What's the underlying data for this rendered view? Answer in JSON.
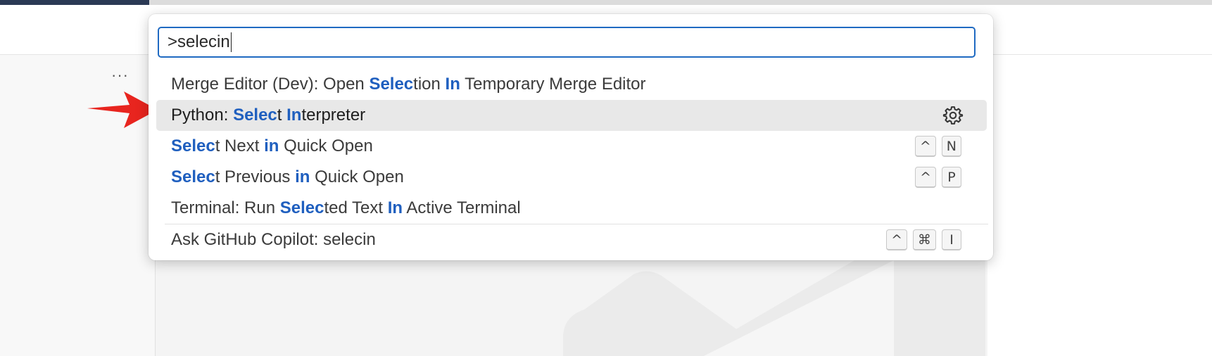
{
  "quick_pick": {
    "query": ">selecin",
    "items": [
      {
        "segments": [
          {
            "t": "Merge Editor (Dev): Open ",
            "h": false
          },
          {
            "t": "Selec",
            "h": true
          },
          {
            "t": "tion ",
            "h": false
          },
          {
            "t": "In",
            "h": true
          },
          {
            "t": " Temporary Merge Editor",
            "h": false
          }
        ],
        "selected": false,
        "keys": []
      },
      {
        "segments": [
          {
            "t": "Python: ",
            "h": false
          },
          {
            "t": "Selec",
            "h": true
          },
          {
            "t": "t ",
            "h": false
          },
          {
            "t": "In",
            "h": true
          },
          {
            "t": "terpreter",
            "h": false
          }
        ],
        "selected": true,
        "action_icon": "gear-icon",
        "keys": []
      },
      {
        "segments": [
          {
            "t": "Selec",
            "h": true
          },
          {
            "t": "t Next ",
            "h": false
          },
          {
            "t": "in",
            "h": true
          },
          {
            "t": " Quick Open",
            "h": false
          }
        ],
        "selected": false,
        "keys": [
          "^",
          "N"
        ]
      },
      {
        "segments": [
          {
            "t": "Selec",
            "h": true
          },
          {
            "t": "t Previous ",
            "h": false
          },
          {
            "t": "in",
            "h": true
          },
          {
            "t": " Quick Open",
            "h": false
          }
        ],
        "selected": false,
        "keys": [
          "^",
          "P"
        ]
      },
      {
        "segments": [
          {
            "t": "Terminal: Run ",
            "h": false
          },
          {
            "t": "Selec",
            "h": true
          },
          {
            "t": "ted Text ",
            "h": false
          },
          {
            "t": "In",
            "h": true
          },
          {
            "t": " Active Terminal",
            "h": false
          }
        ],
        "selected": false,
        "keys": []
      }
    ],
    "copilot_item": {
      "segments": [
        {
          "t": "Ask GitHub Copilot: selecin",
          "h": false
        }
      ],
      "keys": [
        "^",
        "⌘",
        "I"
      ]
    }
  },
  "sidebar": {
    "more_actions": "···"
  },
  "colors": {
    "highlight": "#1f5fbf",
    "input_border": "#1f6ac2",
    "selected_row": "#e8e8e8",
    "annotation_arrow": "#e8251f"
  },
  "icons": {
    "row_action": "gear-icon",
    "annotation": "red-arrow-icon"
  }
}
